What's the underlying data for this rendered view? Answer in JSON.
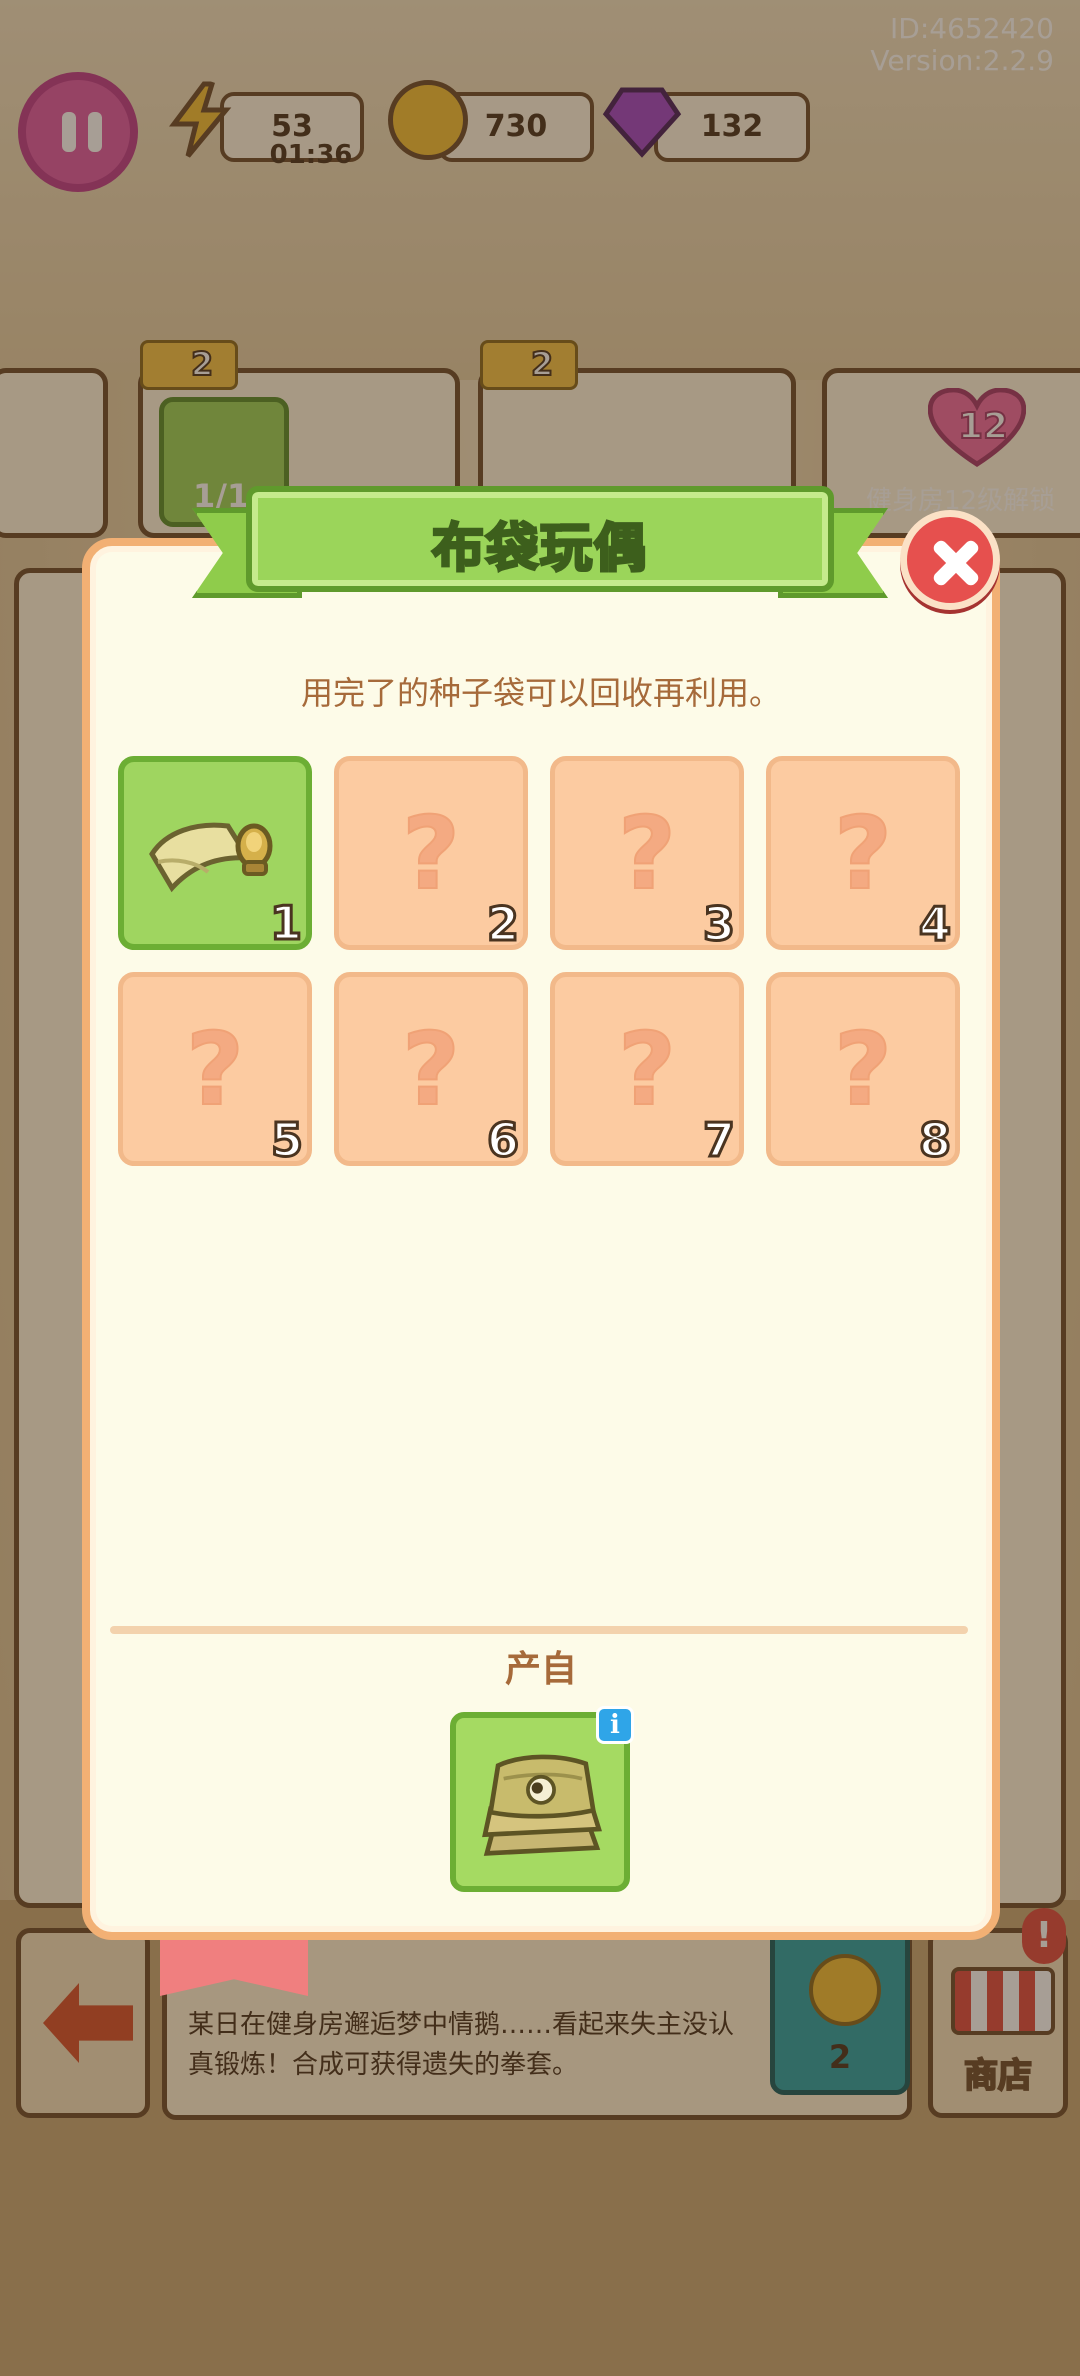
{
  "hud": {
    "id_text": "ID:4652420",
    "version_text": "Version:2.2.9",
    "energy": "53",
    "energy_timer": "01:36",
    "coins": "730",
    "gems": "132"
  },
  "background": {
    "bonus_left": "2",
    "bonus_mid": "2",
    "progress": "1/1",
    "level_badge": "12",
    "unlock_text": "健身房12级解锁",
    "story_text": "某日在健身房邂逅梦中情鹅……看起来失主没认真锻炼！合成可获得遗失的拳套。",
    "shop_label": "商店",
    "coin_count": "2",
    "alert": "!"
  },
  "dialog": {
    "title": "布袋玩偶",
    "description": "用完了的种子袋可以回收再利用。",
    "source_label": "产自",
    "info_icon": "i",
    "slots": [
      {
        "number": "1",
        "state": "found",
        "icon": "cloth-scroll-icon"
      },
      {
        "number": "2",
        "state": "locked",
        "symbol": "?"
      },
      {
        "number": "3",
        "state": "locked",
        "symbol": "?"
      },
      {
        "number": "4",
        "state": "locked",
        "symbol": "?"
      },
      {
        "number": "5",
        "state": "locked",
        "symbol": "?"
      },
      {
        "number": "6",
        "state": "locked",
        "symbol": "?"
      },
      {
        "number": "7",
        "state": "locked",
        "symbol": "?"
      },
      {
        "number": "8",
        "state": "locked",
        "symbol": "?"
      }
    ],
    "source_icon": "seed-bag-stack-icon"
  },
  "colors": {
    "dialog_border": "#f2b074",
    "banner_green": "#9bd55a",
    "found_slot": "#9fd560",
    "locked_slot": "#fccba1",
    "close_red": "#e6504e"
  }
}
